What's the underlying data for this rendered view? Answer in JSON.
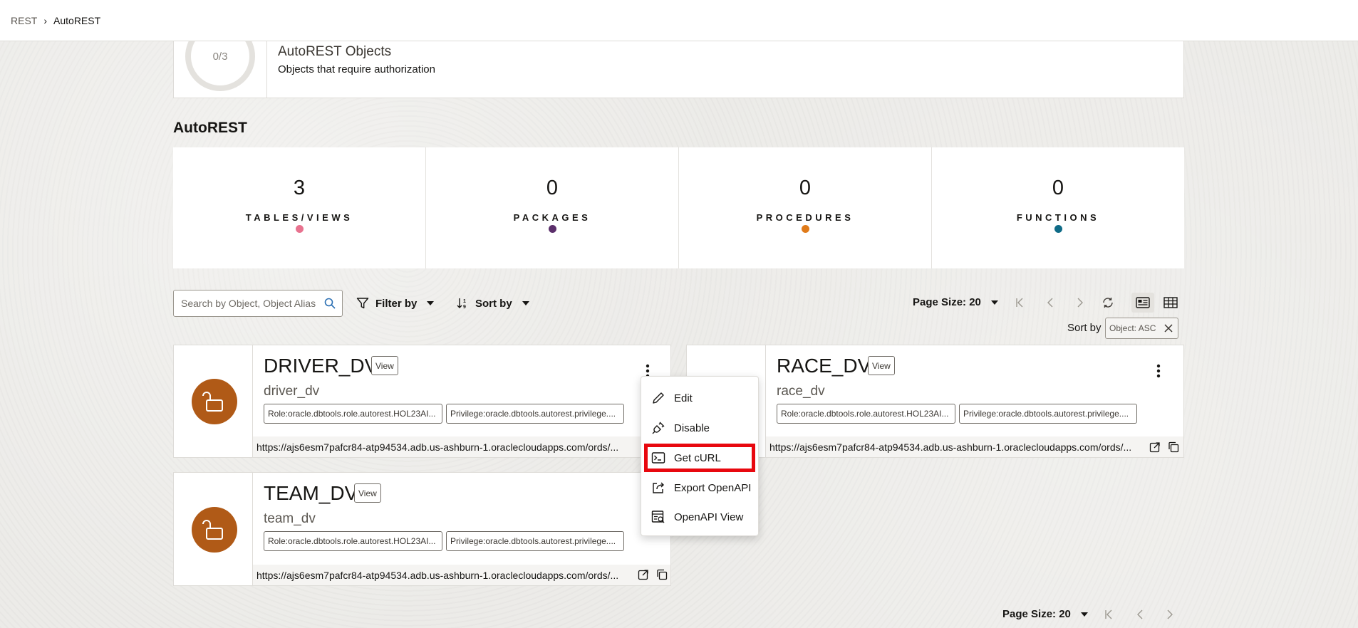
{
  "breadcrumb": {
    "root": "REST",
    "current": "AutoREST"
  },
  "objects_summary": {
    "progress": "0/3",
    "title": "AutoREST Objects",
    "subtitle": "Objects that require authorization"
  },
  "section_title": "AutoREST",
  "stats": [
    {
      "value": "3",
      "label": "TABLES/VIEWS",
      "color": "#e8728f"
    },
    {
      "value": "0",
      "label": "PACKAGES",
      "color": "#5b2f6b"
    },
    {
      "value": "0",
      "label": "PROCEDURES",
      "color": "#e07b1a"
    },
    {
      "value": "0",
      "label": "FUNCTIONS",
      "color": "#0f6b87"
    }
  ],
  "toolbar": {
    "search_placeholder": "Search by Object, Object Alias",
    "filter_label": "Filter by",
    "sort_label": "Sort by",
    "page_size_label": "Page Size: 20"
  },
  "sort_chip": {
    "label": "Sort by",
    "value": "Object: ASC"
  },
  "cards": [
    {
      "name": "DRIVER_DV",
      "view_label": "View",
      "alias": "driver_dv",
      "role_tag": "Role:oracle.dbtools.role.autorest.HOL23AI...",
      "privilege_tag": "Privilege:oracle.dbtools.autorest.privilege....",
      "url": "https://ajs6esm7pafcr84-atp94534.adb.us-ashburn-1.oraclecloudapps.com/ords/..."
    },
    {
      "name": "RACE_DV",
      "view_label": "View",
      "alias": "race_dv",
      "role_tag": "Role:oracle.dbtools.role.autorest.HOL23AI...",
      "privilege_tag": "Privilege:oracle.dbtools.autorest.privilege....",
      "url": "https://ajs6esm7pafcr84-atp94534.adb.us-ashburn-1.oraclecloudapps.com/ords/..."
    },
    {
      "name": "TEAM_DV",
      "view_label": "View",
      "alias": "team_dv",
      "role_tag": "Role:oracle.dbtools.role.autorest.HOL23AI...",
      "privilege_tag": "Privilege:oracle.dbtools.autorest.privilege....",
      "url": "https://ajs6esm7pafcr84-atp94534.adb.us-ashburn-1.oraclecloudapps.com/ords/..."
    }
  ],
  "context_menu": {
    "items": [
      {
        "label": "Edit",
        "icon": "pencil-icon"
      },
      {
        "label": "Disable",
        "icon": "unplug-icon"
      },
      {
        "label": "Get cURL",
        "icon": "terminal-icon",
        "highlighted": true
      },
      {
        "label": "Export OpenAPI",
        "icon": "export-icon"
      },
      {
        "label": "OpenAPI View",
        "icon": "openapi-view-icon"
      }
    ]
  },
  "footer": {
    "page_size_label": "Page Size: 20"
  }
}
